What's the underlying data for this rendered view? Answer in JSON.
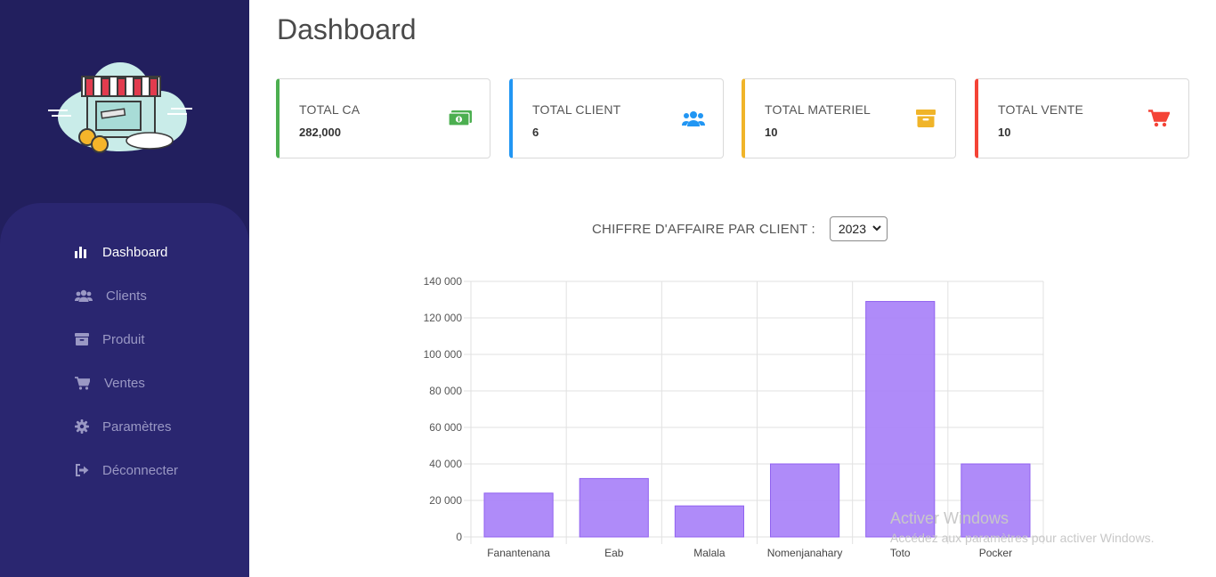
{
  "sidebar": {
    "items": [
      {
        "label": "Dashboard",
        "icon": "bar-chart-icon",
        "active": true
      },
      {
        "label": "Clients",
        "icon": "users-icon",
        "active": false
      },
      {
        "label": "Produit",
        "icon": "archive-icon",
        "active": false
      },
      {
        "label": "Ventes",
        "icon": "cart-icon",
        "active": false
      },
      {
        "label": "Paramètres",
        "icon": "gear-icon",
        "active": false
      },
      {
        "label": "Déconnecter",
        "icon": "sign-out-icon",
        "active": false
      }
    ]
  },
  "main": {
    "title": "Dashboard",
    "cards": [
      {
        "label": "TOTAL CA",
        "value": "282,000",
        "accent": "#4caf50",
        "icon": "money-icon"
      },
      {
        "label": "TOTAL CLIENT",
        "value": "6",
        "accent": "#2196f3",
        "icon": "users-icon"
      },
      {
        "label": "TOTAL MATERIEL",
        "value": "10",
        "accent": "#f0b429",
        "icon": "archive-icon"
      },
      {
        "label": "TOTAL VENTE",
        "value": "10",
        "accent": "#f44336",
        "icon": "cart-icon"
      }
    ],
    "chart_title": "CHIFFRE D'AFFAIRE PAR CLIENT :",
    "year_select": "2023"
  },
  "chart_data": {
    "type": "bar",
    "categories": [
      "Fanantenana",
      "Eab",
      "Malala",
      "Nomenjanahary",
      "Toto",
      "Pocker"
    ],
    "values": [
      24000,
      32000,
      17000,
      40000,
      129000,
      40000
    ],
    "ylim": [
      0,
      140000
    ],
    "yticks": [
      "0",
      "20 000",
      "40 000",
      "60 000",
      "80 000",
      "100 000",
      "120 000",
      "140 000"
    ],
    "grid": true,
    "bar_color": "#a67ef8"
  },
  "watermark": {
    "line1": "Activer Windows",
    "line2": "Accédez aux paramètres pour activer Windows."
  }
}
